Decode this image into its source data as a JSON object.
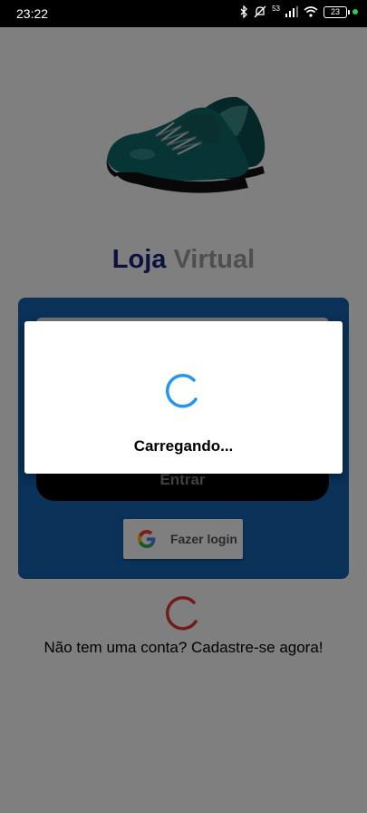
{
  "status_bar": {
    "time": "23:22",
    "network_speed": "53",
    "battery_level": "23",
    "icons": [
      "bluetooth-icon",
      "mute-icon",
      "signal-icon",
      "wifi-icon",
      "battery-icon",
      "privacy-dot-icon"
    ]
  },
  "app": {
    "brand_part1": "Loja",
    "brand_part2": "Virtual",
    "login": {
      "enter_label": "Entrar",
      "google_label": "Fazer login"
    },
    "signup_text": "Não tem uma conta? Cadastre-se agora!"
  },
  "dialog": {
    "message": "Carregando..."
  },
  "nav": {
    "buttons": [
      "recents-button",
      "home-button",
      "back-button"
    ]
  },
  "colors": {
    "brand_primary": "#1a237e",
    "brand_secondary": "#9e9e9e",
    "card_bg": "#1463b0",
    "spinner_blue": "#2196f3",
    "spinner_red": "#e53935",
    "scrim": "rgba(0,0,0,0.5)"
  }
}
